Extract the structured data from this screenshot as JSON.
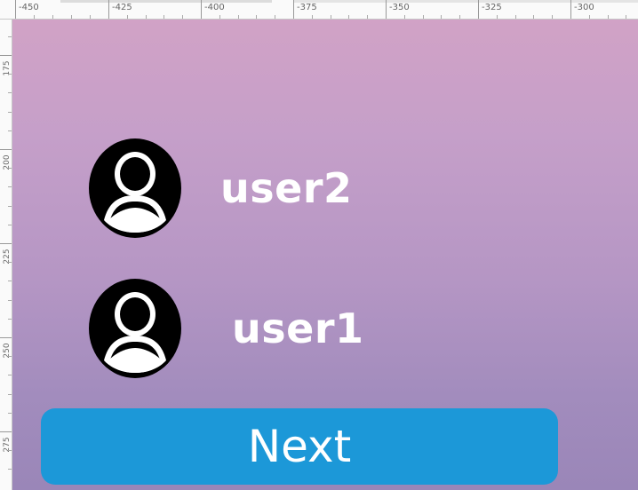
{
  "ruler": {
    "horizontal_labels": [
      "-450",
      "-425",
      "-400",
      "-375",
      "-350",
      "-325",
      "-300"
    ],
    "vertical_labels": [
      "175",
      "200",
      "225",
      "250",
      "275"
    ]
  },
  "users": [
    {
      "name": "user2",
      "icon": "account-circle-icon"
    },
    {
      "name": "user1",
      "icon": "account-circle-icon"
    }
  ],
  "next_button": {
    "label": "Next"
  },
  "colors": {
    "button": "#1c98d8",
    "text": "#ffffff",
    "icon": "#000000",
    "background_top": "#d1a2c6",
    "background_bottom": "#9a86b8"
  }
}
